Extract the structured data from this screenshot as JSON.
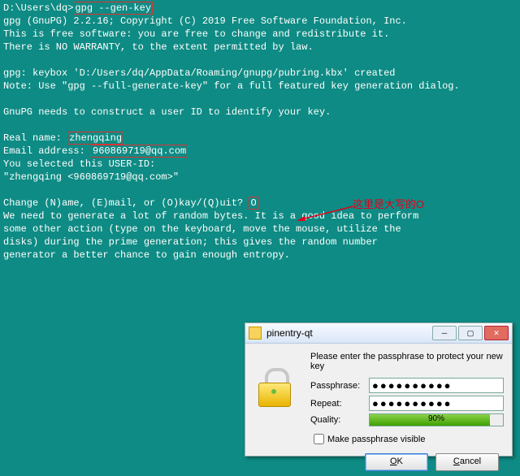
{
  "term": {
    "prompt": "D:\\Users\\dq>",
    "cmd": "gpg --gen-key",
    "l2": "gpg (GnuPG) 2.2.16; Copyright (C) 2019 Free Software Foundation, Inc.",
    "l3": "This is free software: you are free to change and redistribute it.",
    "l4": "There is NO WARRANTY, to the extent permitted by law.",
    "l6": "gpg: keybox 'D:/Users/dq/AppData/Roaming/gnupg/pubring.kbx' created",
    "l7": "Note: Use \"gpg --full-generate-key\" for a full featured key generation dialog.",
    "l9": "GnuPG needs to construct a user ID to identify your key.",
    "name_lbl": "Real name: ",
    "name_val": "zhengqing",
    "email_lbl": "Email address: ",
    "email_val": "960869719@qq.com",
    "l13": "You selected this USER-ID:",
    "l14": "    \"zhengqing <960869719@qq.com>\"",
    "l16a": "Change (N)ame, (E)mail, or (O)kay/(Q)uit? ",
    "l16b": "O",
    "l17": "We need to generate a lot of random bytes. It is a good idea to perform",
    "l18": "some other action (type on the keyboard, move the mouse, utilize the",
    "l19": "disks) during the prime generation; this gives the random number",
    "l20": "generator a better chance to gain enough entropy."
  },
  "annotation": "这里是大写的O",
  "dialog": {
    "title": "pinentry-qt",
    "msg": "Please enter the passphrase to protect your new key",
    "pass_lbl": "Passphrase:",
    "repeat_lbl": "Repeat:",
    "quality_lbl": "Quality:",
    "quality_pct": "90%",
    "chk_lbl": "Make passphrase visible",
    "ok": "OK",
    "cancel": "Cancel",
    "dots1": "●●●●●●●●●●",
    "dots2": "●●●●●●●●●●"
  }
}
